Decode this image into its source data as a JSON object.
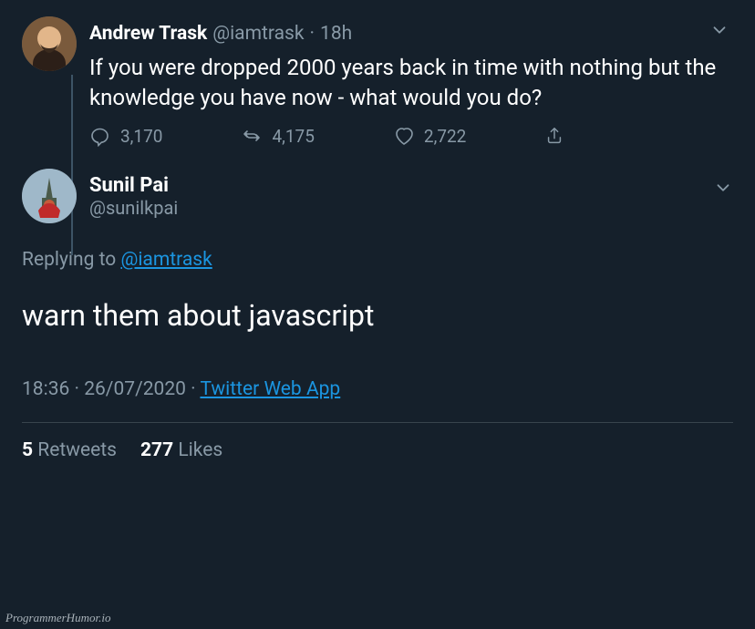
{
  "quoted": {
    "display_name": "Andrew Trask",
    "handle": "@iamtrask",
    "separator": "·",
    "time": "18h",
    "text": "If you were dropped 2000 years back in time with nothing but the knowledge you have now - what would you do?",
    "replies": "3,170",
    "retweets": "4,175",
    "likes": "2,722"
  },
  "main": {
    "display_name": "Sunil Pai",
    "handle": "@sunilkpai",
    "replying_prefix": "Replying to ",
    "replying_mention": "@iamtrask",
    "text": "warn them about javascript",
    "time": "18:36",
    "date": "26/07/2020",
    "source": "Twitter Web App",
    "separator": " · "
  },
  "stats": {
    "retweets_count": "5",
    "retweets_label": " Retweets",
    "likes_count": "277",
    "likes_label": " Likes"
  },
  "watermark": "ProgrammerHumor.io"
}
